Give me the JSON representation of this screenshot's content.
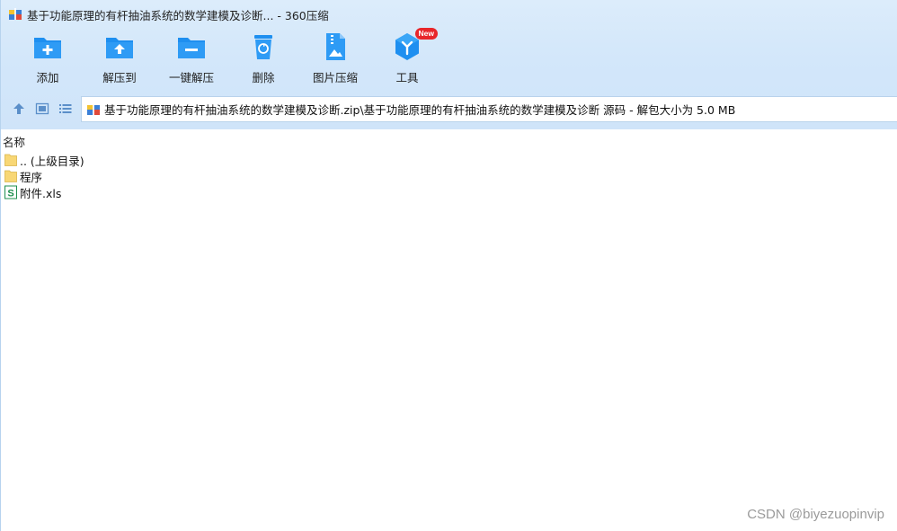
{
  "window": {
    "title": "基于功能原理的有杆抽油系统的数学建模及诊断... - 360压缩"
  },
  "toolbar": {
    "items": [
      {
        "label": "添加",
        "icon": "add-folder-icon"
      },
      {
        "label": "解压到",
        "icon": "extract-to-icon"
      },
      {
        "label": "一键解压",
        "icon": "one-click-extract-icon"
      },
      {
        "label": "删除",
        "icon": "trash-icon"
      },
      {
        "label": "图片压缩",
        "icon": "image-compress-icon"
      },
      {
        "label": "工具",
        "icon": "tools-cube-icon",
        "badge": "New"
      }
    ]
  },
  "nav": {
    "path": "基于功能原理的有杆抽油系统的数学建模及诊断.zip\\基于功能原理的有杆抽油系统的数学建模及诊断 源码 - 解包大小为 5.0 MB"
  },
  "list": {
    "column_name": "名称",
    "rows": [
      {
        "name": ".. (上级目录)",
        "type": "folder"
      },
      {
        "name": "程序",
        "type": "folder"
      },
      {
        "name": "附件.xls",
        "type": "spreadsheet"
      }
    ]
  },
  "watermark": "CSDN @biyezuopinvip",
  "colors": {
    "accent": "#1e8ff0",
    "band": "#d3e7fa",
    "folder": "#f8d775",
    "badge": "#e8262a"
  }
}
